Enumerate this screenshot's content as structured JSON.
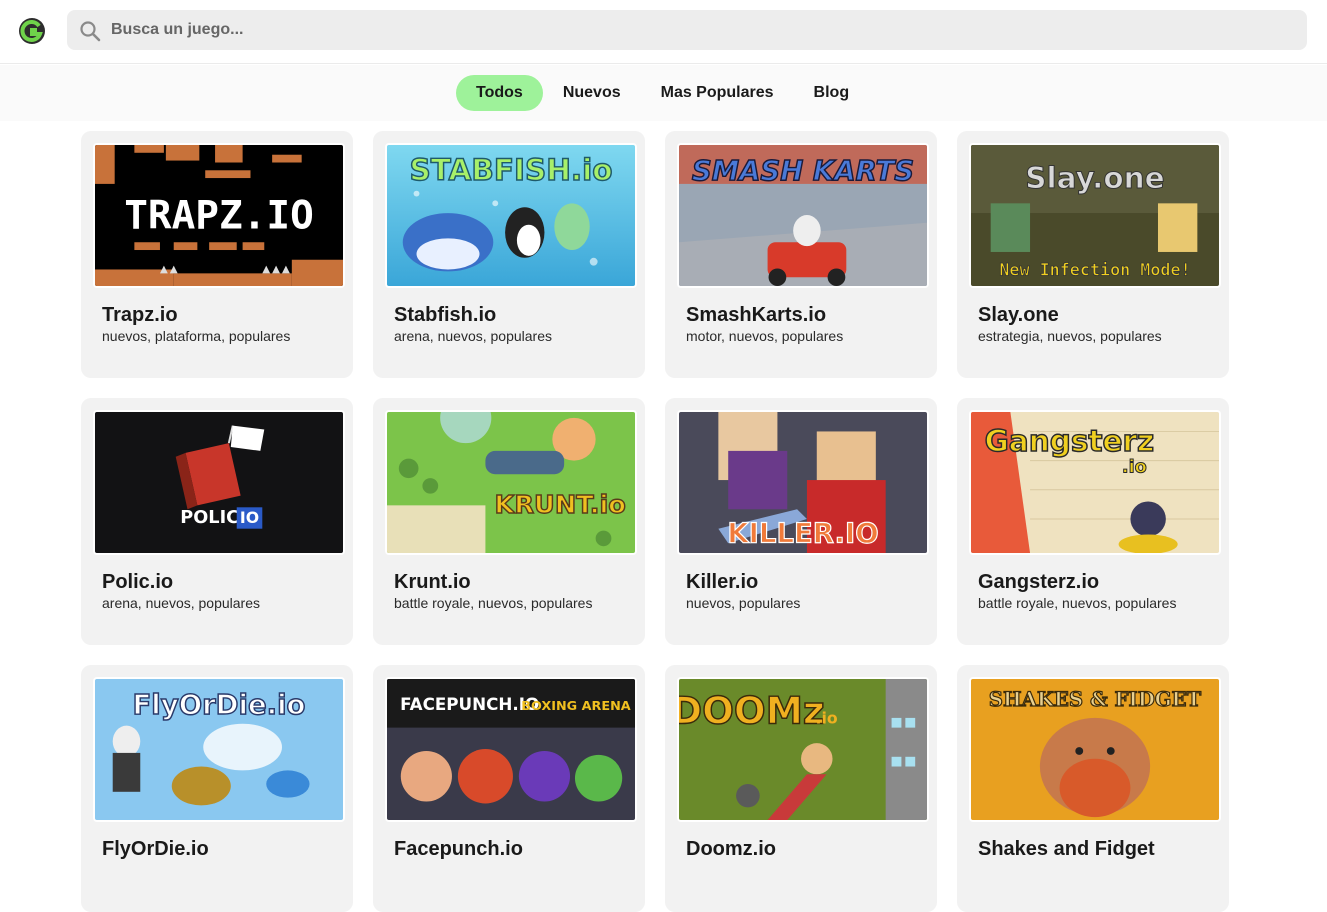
{
  "header": {
    "logo_icon": "g-logo-icon",
    "search_icon": "search-icon",
    "search_placeholder": "Busca un juego..."
  },
  "nav": {
    "tabs": [
      {
        "label": "Todos",
        "active": true
      },
      {
        "label": "Nuevos",
        "active": false
      },
      {
        "label": "Mas Populares",
        "active": false
      },
      {
        "label": "Blog",
        "active": false
      }
    ],
    "active_color": "#9ef29a"
  },
  "games": [
    {
      "title": "Trapz.io",
      "tags": "nuevos, plataforma, populares",
      "thumb_text": "TRAPZ.IO"
    },
    {
      "title": "Stabfish.io",
      "tags": "arena, nuevos, populares",
      "thumb_text": "STABFISH.io"
    },
    {
      "title": "SmashKarts.io",
      "tags": "motor, nuevos, populares",
      "thumb_text": "SMASH KARTS"
    },
    {
      "title": "Slay.one",
      "tags": "estrategia, nuevos, populares",
      "thumb_text": "Slay.one",
      "thumb_sub": "New Infection Mode!"
    },
    {
      "title": "Polic.io",
      "tags": "arena, nuevos, populares",
      "thumb_text": "POLIC.",
      "thumb_sub": "IO"
    },
    {
      "title": "Krunt.io",
      "tags": "battle royale, nuevos, populares",
      "thumb_text": "KRUNT.io"
    },
    {
      "title": "Killer.io",
      "tags": "nuevos, populares",
      "thumb_text": "KILLER.IO"
    },
    {
      "title": "Gangsterz.io",
      "tags": "battle royale, nuevos, populares",
      "thumb_text": "Gangsterz",
      "thumb_sub": ".io"
    },
    {
      "title": "FlyOrDie.io",
      "tags": "",
      "thumb_text": "FlyOrDie.io"
    },
    {
      "title": "Facepunch.io",
      "tags": "",
      "thumb_text": "FACEPUNCH.IO",
      "thumb_sub": "BOXING ARENA"
    },
    {
      "title": "Doomz.io",
      "tags": "",
      "thumb_text": "DOOMz",
      "thumb_sub": ".io"
    },
    {
      "title": "Shakes and Fidget",
      "tags": "",
      "thumb_text": "SHAKES & FIDGET"
    }
  ]
}
